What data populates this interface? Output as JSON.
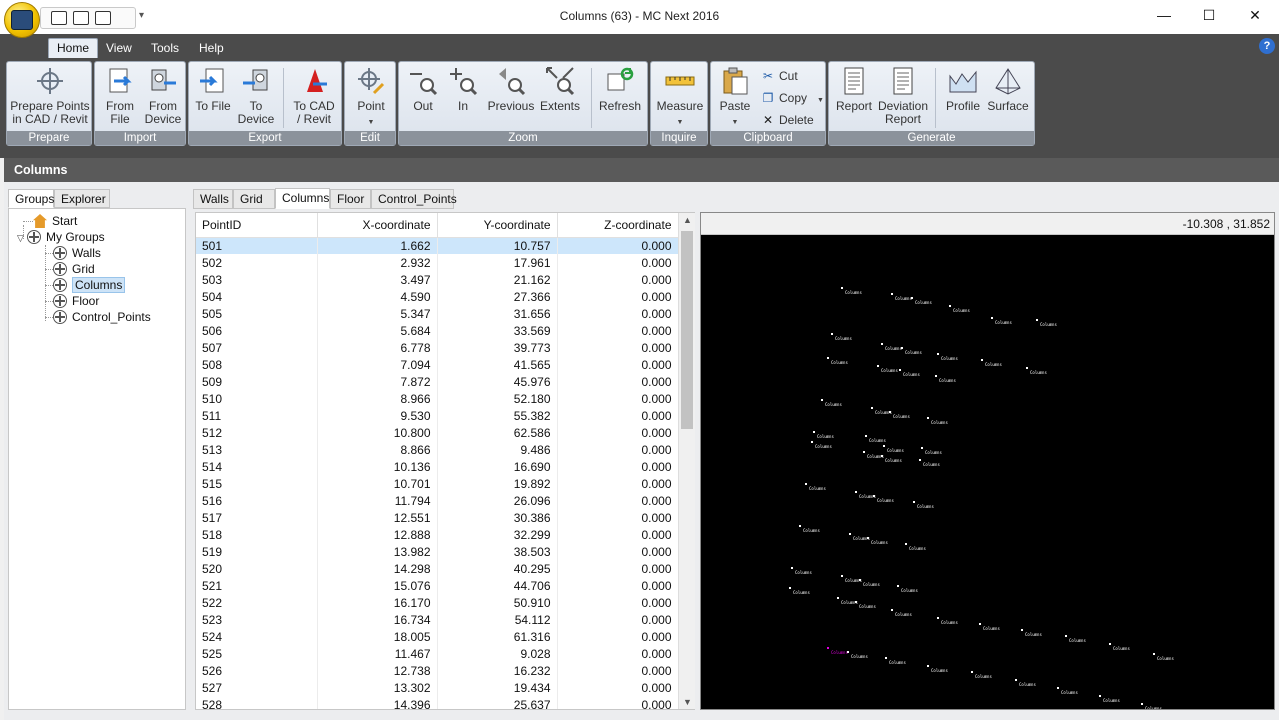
{
  "window": {
    "title": "Columns (63) - MC Next 2016",
    "controls": {
      "minimize": "—",
      "maximize": "☐",
      "close": "✕"
    }
  },
  "ribbon_tabs": [
    "Home",
    "View",
    "Tools",
    "Help"
  ],
  "ribbon": {
    "prepare": {
      "label": "Prepare",
      "button": "Prepare Points\nin CAD / Revit"
    },
    "import": {
      "label": "Import",
      "from_file": "From\nFile",
      "from_device": "From\nDevice"
    },
    "export": {
      "label": "Export",
      "to_file": "To File",
      "to_device": "To\nDevice",
      "to_cad": "To CAD\n/ Revit"
    },
    "edit": {
      "label": "Edit",
      "point": "Point"
    },
    "zoom": {
      "label": "Zoom",
      "out": "Out",
      "in": "In",
      "previous": "Previous",
      "extents": "Extents",
      "refresh": "Refresh"
    },
    "inquire": {
      "label": "Inquire",
      "measure": "Measure"
    },
    "clipboard": {
      "label": "Clipboard",
      "paste": "Paste",
      "cut": "Cut",
      "copy": "Copy",
      "delete": "Delete"
    },
    "generate": {
      "label": "Generate",
      "report": "Report",
      "deviation_report": "Deviation\nReport",
      "profile": "Profile",
      "surface": "Surface"
    }
  },
  "panel_title": "Columns",
  "left_tabs": [
    "Groups",
    "Explorer"
  ],
  "tree": {
    "start": "Start",
    "my_groups": "My Groups",
    "groups": [
      "Walls",
      "Grid",
      "Columns",
      "Floor",
      "Control_Points"
    ],
    "selected": "Columns"
  },
  "content_tabs": [
    "Walls",
    "Grid",
    "Columns",
    "Floor",
    "Control_Points"
  ],
  "table": {
    "headers": [
      "PointID",
      "X-coordinate",
      "Y-coordinate",
      "Z-coordinate"
    ],
    "rows": [
      [
        "501",
        "1.662",
        "10.757",
        "0.000"
      ],
      [
        "502",
        "2.932",
        "17.961",
        "0.000"
      ],
      [
        "503",
        "3.497",
        "21.162",
        "0.000"
      ],
      [
        "504",
        "4.590",
        "27.366",
        "0.000"
      ],
      [
        "505",
        "5.347",
        "31.656",
        "0.000"
      ],
      [
        "506",
        "5.684",
        "33.569",
        "0.000"
      ],
      [
        "507",
        "6.778",
        "39.773",
        "0.000"
      ],
      [
        "508",
        "7.094",
        "41.565",
        "0.000"
      ],
      [
        "509",
        "7.872",
        "45.976",
        "0.000"
      ],
      [
        "510",
        "8.966",
        "52.180",
        "0.000"
      ],
      [
        "511",
        "9.530",
        "55.382",
        "0.000"
      ],
      [
        "512",
        "10.800",
        "62.586",
        "0.000"
      ],
      [
        "513",
        "8.866",
        "9.486",
        "0.000"
      ],
      [
        "514",
        "10.136",
        "16.690",
        "0.000"
      ],
      [
        "515",
        "10.701",
        "19.892",
        "0.000"
      ],
      [
        "516",
        "11.794",
        "26.096",
        "0.000"
      ],
      [
        "517",
        "12.551",
        "30.386",
        "0.000"
      ],
      [
        "518",
        "12.888",
        "32.299",
        "0.000"
      ],
      [
        "519",
        "13.982",
        "38.503",
        "0.000"
      ],
      [
        "520",
        "14.298",
        "40.295",
        "0.000"
      ],
      [
        "521",
        "15.076",
        "44.706",
        "0.000"
      ],
      [
        "522",
        "16.170",
        "50.910",
        "0.000"
      ],
      [
        "523",
        "16.734",
        "54.112",
        "0.000"
      ],
      [
        "524",
        "18.005",
        "61.316",
        "0.000"
      ],
      [
        "525",
        "11.467",
        "9.028",
        "0.000"
      ],
      [
        "526",
        "12.738",
        "16.232",
        "0.000"
      ],
      [
        "527",
        "13.302",
        "19.434",
        "0.000"
      ],
      [
        "528",
        "14.396",
        "25.637",
        "0.000"
      ]
    ],
    "selected_row": "501"
  },
  "viewer": {
    "cursor_coords": "-10.308 , 31.852",
    "point_label": "Columns",
    "highlight_color": "#e000e0"
  },
  "colors": {
    "ribbon_bg": "#4b4b4b",
    "selection": "#cde6fb",
    "viewer_bg": "#000000"
  }
}
